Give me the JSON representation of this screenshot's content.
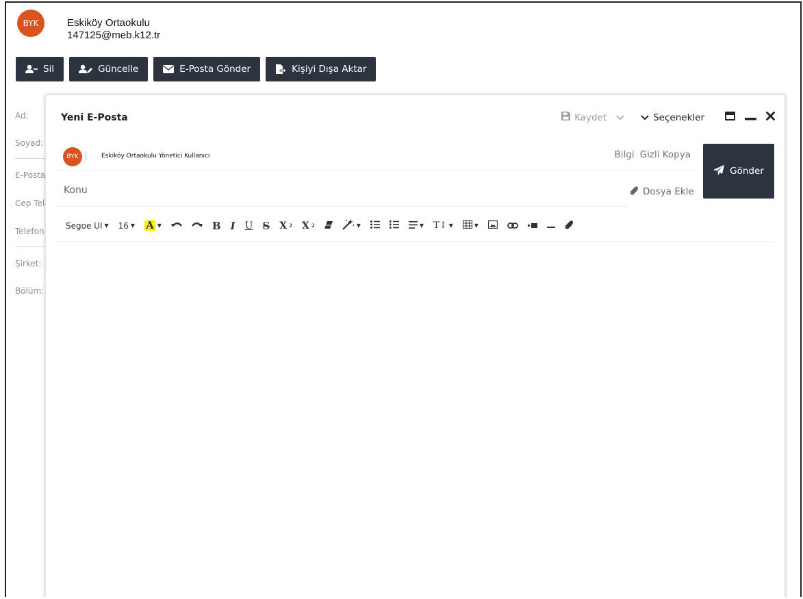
{
  "contact": {
    "avatar_initials": "BYK",
    "name": "Eskiköy Ortaokulu",
    "email": "147125@meb.k12.tr"
  },
  "actions": [
    {
      "label": "Sil",
      "icon": "user-minus-icon"
    },
    {
      "label": "Güncelle",
      "icon": "user-edit-icon"
    },
    {
      "label": "E-Posta Gönder",
      "icon": "envelope-icon"
    },
    {
      "label": "Kişiyi Dışa Aktar",
      "icon": "export-icon"
    }
  ],
  "sidebar": {
    "labels": [
      "Ad:",
      "Soyad:",
      "E-Posta",
      "Cep Tel",
      "Telefon",
      "Şirket:",
      "Bölüm:"
    ]
  },
  "compose": {
    "title": "Yeni E-Posta",
    "save_label": "Kaydet",
    "options_label": "Seçenekler",
    "from_initials": "BYK",
    "from_name": "Eskiköy Ortaokulu Yönetici Kullanıcı",
    "cc_label": "Bilgi",
    "bcc_label": "Gizli Kopya",
    "send_label": "Gönder",
    "subject_placeholder": "Konu",
    "attach_label": "Dosya Ekle"
  },
  "toolbar": {
    "font_family": "Segoe UI",
    "font_size": "16",
    "bold": "B",
    "italic": "I",
    "underline": "U",
    "strike": "S",
    "superscript": "X",
    "subscript": "X",
    "font_color_letter": "A",
    "text_size_label": "T↕"
  },
  "colors": {
    "accent_dark": "#2d3440",
    "avatar_orange": "#d9531e",
    "highlight_yellow": "#fff200"
  }
}
